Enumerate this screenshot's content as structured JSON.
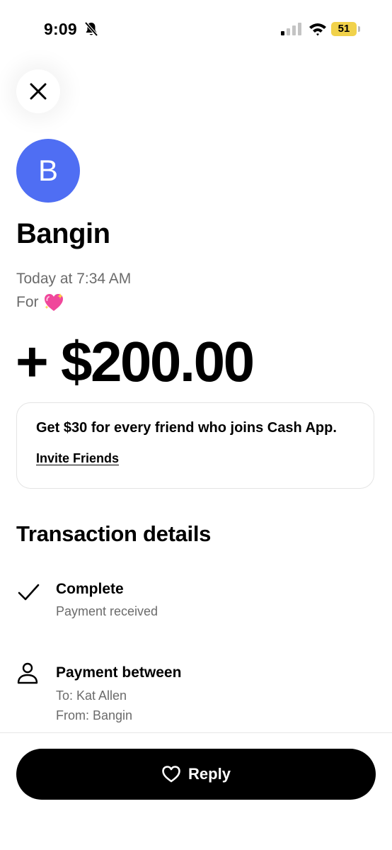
{
  "status_bar": {
    "time": "9:09",
    "battery": "51",
    "icons": [
      "bell-slash-icon",
      "signal-icon",
      "wifi-icon",
      "battery-icon"
    ]
  },
  "header": {
    "close_icon": "close-icon"
  },
  "sender": {
    "avatar_letter": "B",
    "avatar_color": "#4f6ef3",
    "name": "Bangin"
  },
  "payment": {
    "timestamp": "Today at 7:34 AM",
    "for_label": "For",
    "for_emoji": "sparkling-heart-icon",
    "amount": "+ $200.00"
  },
  "promo": {
    "text": "Get $30 for every friend who joins Cash App.",
    "link": "Invite Friends"
  },
  "details": {
    "title": "Transaction details",
    "status": {
      "icon": "checkmark-icon",
      "title": "Complete",
      "subtitle": "Payment received"
    },
    "parties": {
      "icon": "person-icon",
      "title": "Payment between",
      "to": "To: Kat Allen",
      "from": "From: Bangin"
    }
  },
  "footer": {
    "reply_label": "Reply",
    "reply_icon": "heart-outline-icon"
  },
  "colors": {
    "accent_blue": "#4f6ef3",
    "battery_yellow": "#f1d24b",
    "muted_text": "#6b6b6b",
    "button_black": "#000000"
  }
}
